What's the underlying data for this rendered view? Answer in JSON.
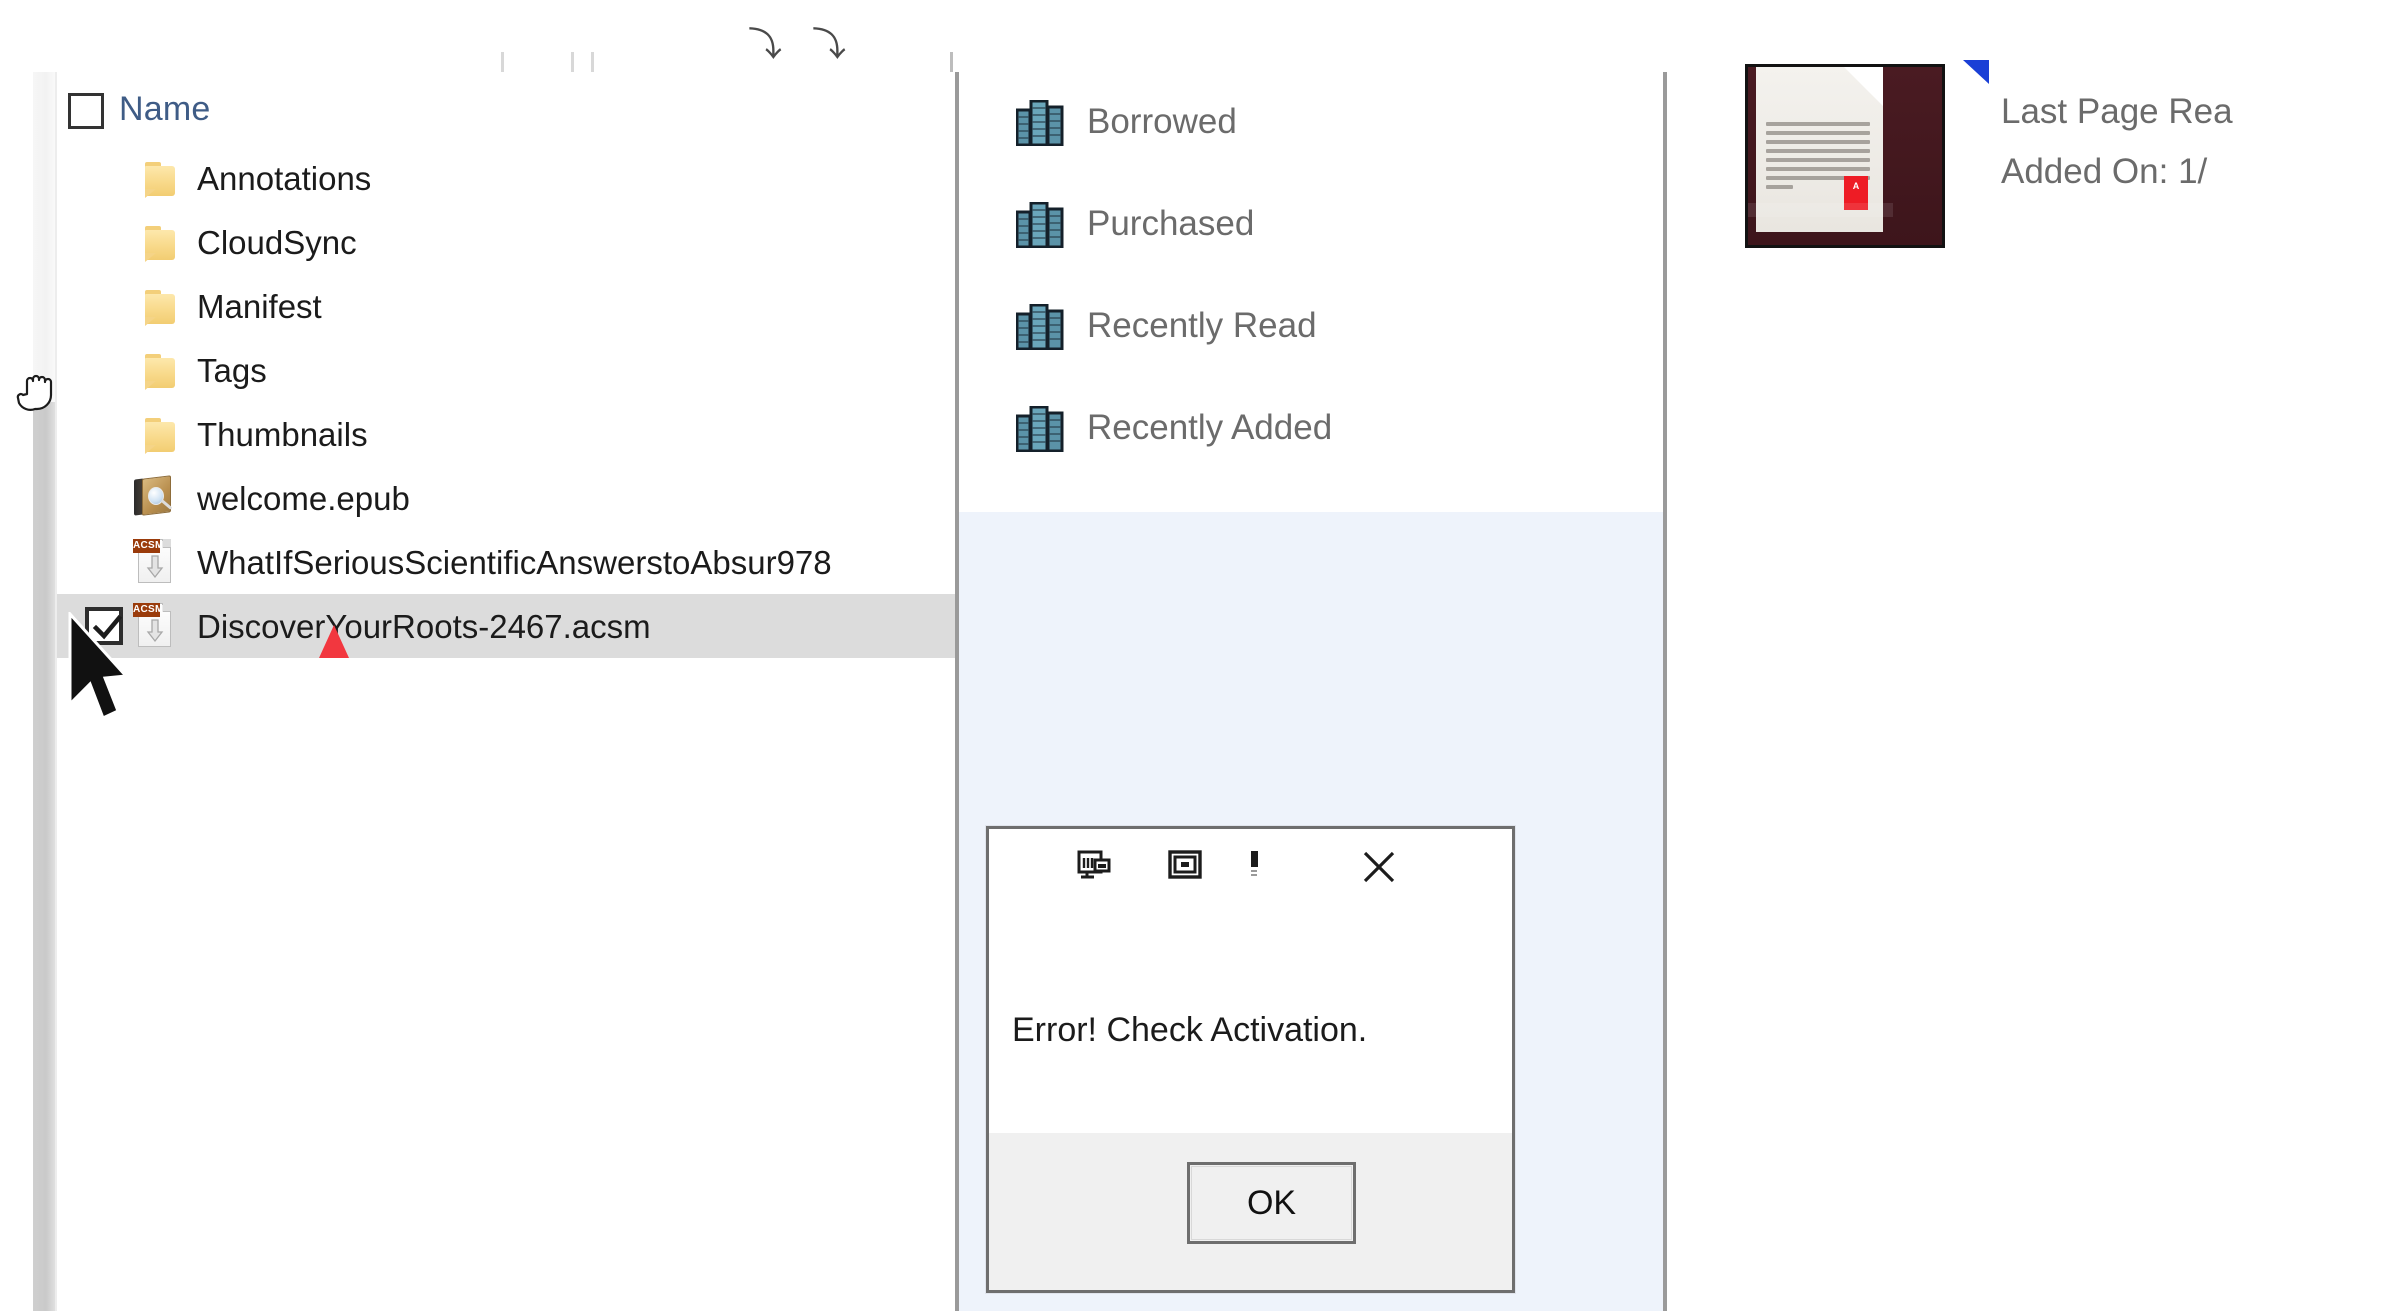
{
  "toolbar": {
    "sort_caret": "∧",
    "glyph_left": "⤵",
    "glyph_right": "⤵"
  },
  "file_list": {
    "header": {
      "name_label": "Name",
      "select_all_checked": false
    },
    "rows": [
      {
        "label": "Annotations",
        "icon": "folder-icon",
        "checked": null,
        "selected": false
      },
      {
        "label": "CloudSync",
        "icon": "folder-icon",
        "checked": null,
        "selected": false
      },
      {
        "label": "Manifest",
        "icon": "folder-icon",
        "checked": null,
        "selected": false
      },
      {
        "label": "Tags",
        "icon": "folder-icon",
        "checked": null,
        "selected": false
      },
      {
        "label": "Thumbnails",
        "icon": "folder-icon",
        "checked": null,
        "selected": false
      },
      {
        "label": "welcome.epub",
        "icon": "epub-icon",
        "checked": null,
        "selected": false
      },
      {
        "label": "WhatIfSeriousScientificAnswerstoAbsur978",
        "icon": "acsm-icon",
        "checked": null,
        "selected": false
      },
      {
        "label": "DiscoverYourRoots-2467.acsm",
        "icon": "acsm-icon",
        "checked": true,
        "selected": true
      }
    ],
    "acsm_badge_text": "ACSM"
  },
  "library": {
    "shelves": [
      {
        "label": "Borrowed",
        "icon": "bookshelf-icon"
      },
      {
        "label": "Purchased",
        "icon": "bookshelf-icon"
      },
      {
        "label": "Recently Read",
        "icon": "bookshelf-icon"
      },
      {
        "label": "Recently Added",
        "icon": "bookshelf-icon"
      }
    ]
  },
  "details": {
    "last_page_read": "Last Page Rea",
    "added_on": "Added On:  1/",
    "thumbnail_logo_text": "A"
  },
  "dialog": {
    "message": "Error! Check Activation.",
    "ok_label": "OK",
    "titlebar_icons": [
      "window-restore-icon",
      "window-maximize-icon",
      "window-minimize-icon"
    ],
    "close_label": "✕"
  },
  "colors": {
    "accent_blue": "#3f5c86",
    "shelf_teal": "#5b93a8",
    "selected_row": "#dcdcdc",
    "panel_blue": "#eef3fb",
    "acsm_badge": "#9a3b0b",
    "book_cover": "#4a1b22",
    "red_marker": "#ee1c25",
    "dialog_border": "#6e6e6e"
  }
}
